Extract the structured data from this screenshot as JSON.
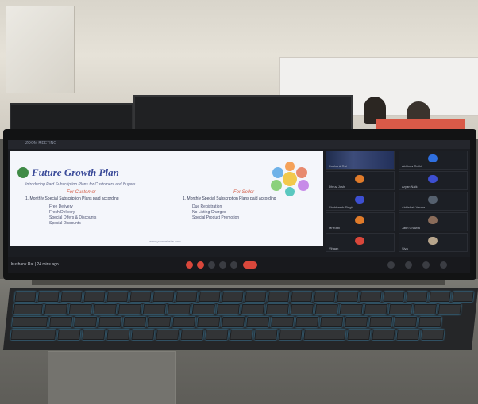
{
  "window": {
    "title": "ZOOM MEETING"
  },
  "slide": {
    "title": "Future Growth Plan",
    "subtitle": "Introducing Paid Subscription Plans for Customers and Buyers",
    "left_heading": "For Customer",
    "left_text": "1. Monthly Special Subscription Plans paid according",
    "left_bullets": [
      "Free Delivery",
      "Fresh Delivery",
      "Special Offers & Discounts",
      "Special Discounts"
    ],
    "right_heading": "For Seller",
    "right_text": "1. Monthly Special Subscription Plans paid according",
    "right_bullets": [
      "Due Registration",
      "No Listing Charges",
      "Special Product Promotion"
    ],
    "footer": "www.yourwebsite.com"
  },
  "participants": [
    {
      "name": "Kushank Rai",
      "avatar": "video",
      "color": "#3d4c7a"
    },
    {
      "name": "Abhinav Rathi",
      "avatar": "D",
      "color": "#2f6fe0"
    },
    {
      "name": "Dhruv Joshi",
      "avatar": "orange",
      "color": "#e07b2a"
    },
    {
      "name": "Aryan Naik",
      "avatar": "n",
      "color": "#3d4fd1"
    },
    {
      "name": "Shubhamb Singh",
      "avatar": "V",
      "color": "#3d4fd1"
    },
    {
      "name": "Abhishek Verma",
      "avatar": "photo",
      "color": "#55606e"
    },
    {
      "name": "Mr Rabi",
      "avatar": "orange",
      "color": "#e07b2a"
    },
    {
      "name": "Jatin Chawla",
      "avatar": "photo",
      "color": "#8a6c5a"
    },
    {
      "name": "Vihaan",
      "avatar": "red",
      "color": "#d9473b"
    },
    {
      "name": "Siya",
      "avatar": "photo",
      "color": "#b7a58c"
    }
  ],
  "bottom_bar": {
    "left_label": "Kushank Rai  |  24 mins ago"
  }
}
